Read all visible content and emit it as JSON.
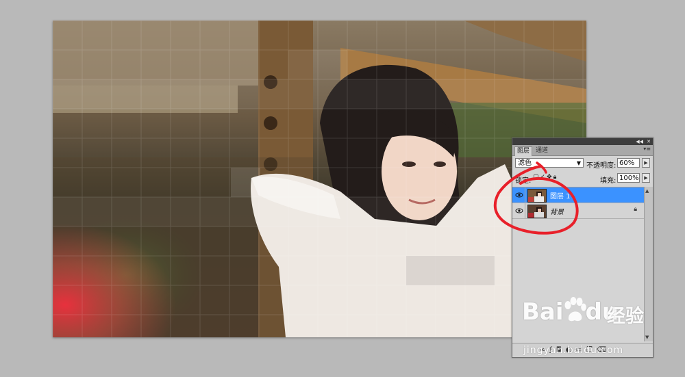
{
  "panel": {
    "tabs": {
      "layers": "图层",
      "channels": "通道"
    },
    "blend_mode": "滤色",
    "opacity_label": "不透明度:",
    "opacity_value": "60%",
    "lock_label": "锁定:",
    "fill_label": "填充:",
    "fill_value": "100%",
    "layers": [
      {
        "name": "图层 1",
        "selected": true
      },
      {
        "name": "背景",
        "selected": false,
        "locked": true
      }
    ]
  },
  "icons": {
    "collapse": "double-arrow-icon",
    "close": "close-icon",
    "menu": "panel-menu-icon",
    "dropdown": "chevron-down-icon",
    "stepper": "chevron-right-icon",
    "eye": "eye-icon",
    "lock": "lock-icon"
  },
  "watermark": {
    "logo": "Bai",
    "logo_suffix": "du",
    "cn": "经验",
    "url": "jingyan.baidu.com"
  },
  "annotation_color": "#e8202a",
  "selection_color": "#3b92ff"
}
